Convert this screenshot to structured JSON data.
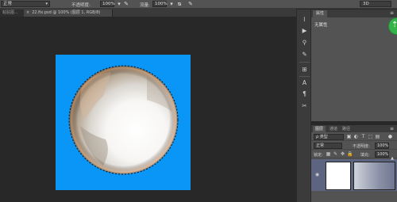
{
  "options_bar": {
    "mode": "正常",
    "opacity_label": "不透明度:",
    "opacity_value": "100%",
    "flow_label": "流量:",
    "flow_value": "100%",
    "right_field": "3D"
  },
  "tabs": {
    "inactive": "粘贴图...",
    "active": "22.fix.psd @ 100% (图层 1, RGB/8)"
  },
  "properties_panel": {
    "tab": "属性",
    "label": "无属性"
  },
  "layers_panel": {
    "tabs": [
      "图层",
      "通道",
      "路径"
    ],
    "filter_kind": "ρ 类型",
    "blend_mode": "正常",
    "opacity_label": "不透明度:",
    "opacity_value": "100%",
    "lock_label": "锁定:",
    "fill_label": "填充:",
    "fill_value": "100%"
  },
  "colors": {
    "canvas_bg": "#0996f6",
    "accent_green": "#33b34a",
    "selected_layer": "#5c6480"
  }
}
